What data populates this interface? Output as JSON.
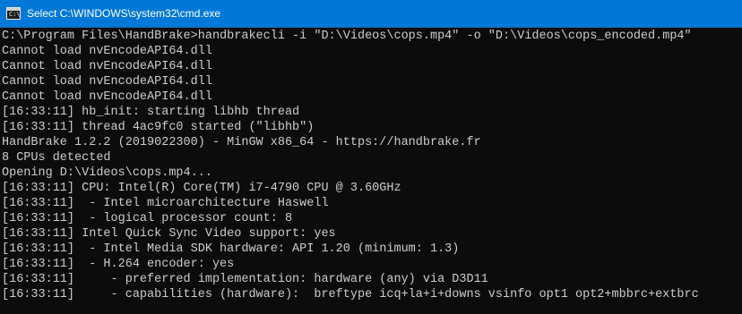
{
  "window": {
    "title": "Select C:\\WINDOWS\\system32\\cmd.exe",
    "icon": "cmd-icon",
    "icon_glyph": "C:\\",
    "background": "#0c0c0c",
    "text_color": "#cccccc",
    "titlebar_color": "#0078d7"
  },
  "console": {
    "lines": [
      "C:\\Program Files\\HandBrake>handbrakecli -i \"D:\\Videos\\cops.mp4\" -o \"D:\\Videos\\cops_encoded.mp4\"",
      "Cannot load nvEncodeAPI64.dll",
      "Cannot load nvEncodeAPI64.dll",
      "Cannot load nvEncodeAPI64.dll",
      "Cannot load nvEncodeAPI64.dll",
      "[16:33:11] hb_init: starting libhb thread",
      "[16:33:11] thread 4ac9fc0 started (\"libhb\")",
      "HandBrake 1.2.2 (2019022300) - MinGW x86_64 - https://handbrake.fr",
      "8 CPUs detected",
      "Opening D:\\Videos\\cops.mp4...",
      "[16:33:11] CPU: Intel(R) Core(TM) i7-4790 CPU @ 3.60GHz",
      "[16:33:11]  - Intel microarchitecture Haswell",
      "[16:33:11]  - logical processor count: 8",
      "[16:33:11] Intel Quick Sync Video support: yes",
      "[16:33:11]  - Intel Media SDK hardware: API 1.20 (minimum: 1.3)",
      "[16:33:11]  - H.264 encoder: yes",
      "[16:33:11]     - preferred implementation: hardware (any) via D3D11",
      "[16:33:11]     - capabilities (hardware):  breftype icq+la+i+downs vsinfo opt1 opt2+mbbrc+extbrc"
    ]
  }
}
